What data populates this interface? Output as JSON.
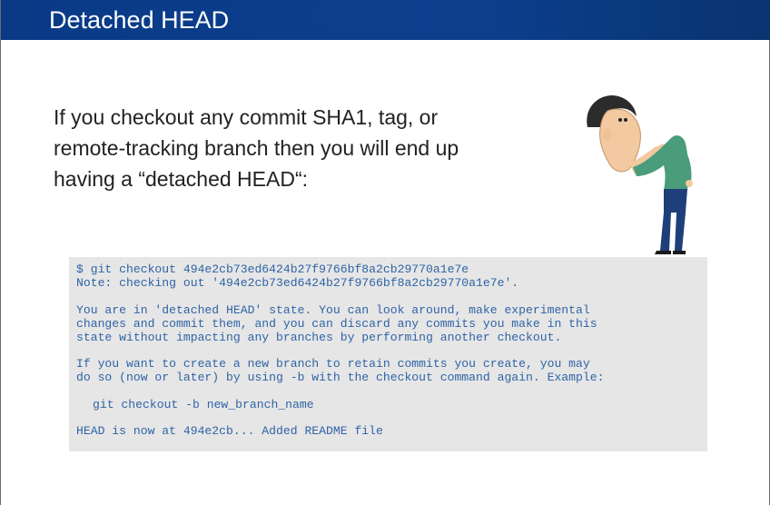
{
  "slide": {
    "title": "Detached HEAD",
    "body_lines": [
      "If you checkout any commit SHA1, tag, or",
      "remote-tracking branch then you will end up",
      "having a “detached HEAD“:"
    ],
    "illustration": "confused-person-figure"
  },
  "terminal": {
    "command": "$ git checkout 494e2cb73ed6424b27f9766bf8a2cb29770a1e7e",
    "note": "Note: checking out '494e2cb73ed6424b27f9766bf8a2cb29770a1e7e'.",
    "para1": [
      "You are in 'detached HEAD' state. You can look around, make experimental",
      "changes and commit them, and you can discard any commits you make in this",
      "state without impacting any branches by performing another checkout."
    ],
    "para2": [
      "If you want to create a new branch to retain commits you create, you may",
      "do so (now or later) by using -b with the checkout command again. Example:"
    ],
    "example": "git checkout -b new_branch_name",
    "head_status": "HEAD is now at 494e2cb... Added README file"
  },
  "colors": {
    "title_bar": "#0b3f8e",
    "terminal_bg": "#e6e6e6",
    "terminal_text": "#2f64a6"
  }
}
